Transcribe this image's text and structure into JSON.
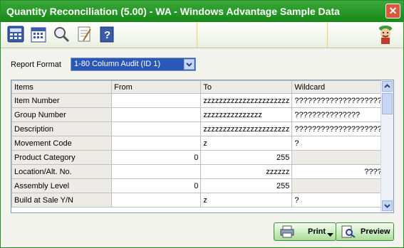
{
  "window": {
    "title": "Quantity Reconciliation (5.00) - WA - Windows Advantage Sample Data",
    "close_glyph": "✕"
  },
  "toolbar": {
    "icons": [
      "calculator-icon",
      "calendar-icon",
      "magnifier-icon",
      "notepad-icon",
      "help-book-icon"
    ]
  },
  "report": {
    "label": "Report Format",
    "value": "1-80 Column Audit (ID 1)"
  },
  "grid": {
    "headers": [
      "Items",
      "From",
      "To",
      "Wildcard"
    ],
    "rows": [
      {
        "item": "Item Number",
        "from": "",
        "to": "zzzzzzzzzzzzzzzzzzzzzz",
        "wildcard": "??????????????????????"
      },
      {
        "item": "Group Number",
        "from": "",
        "to": "zzzzzzzzzzzzzzz",
        "wildcard": "???????????????"
      },
      {
        "item": "Description",
        "from": "",
        "to": "zzzzzzzzzzzzzzzzzzzzzz",
        "wildcard": "??????????????????????"
      },
      {
        "item": "Movement Code",
        "from": "",
        "to": "z",
        "wildcard": "?"
      },
      {
        "item": "Product Category",
        "from": "0",
        "to": "255",
        "wildcard": ""
      },
      {
        "item": "Location/Alt. No.",
        "from": "",
        "to": "zzzzzz",
        "wildcard": "??????"
      },
      {
        "item": "Assembly Level",
        "from": "0",
        "to": "255",
        "wildcard": ""
      },
      {
        "item": "Build at Sale Y/N",
        "from": "",
        "to": "z",
        "wildcard": "?"
      }
    ]
  },
  "buttons": {
    "print": "Print",
    "preview": "Preview"
  }
}
